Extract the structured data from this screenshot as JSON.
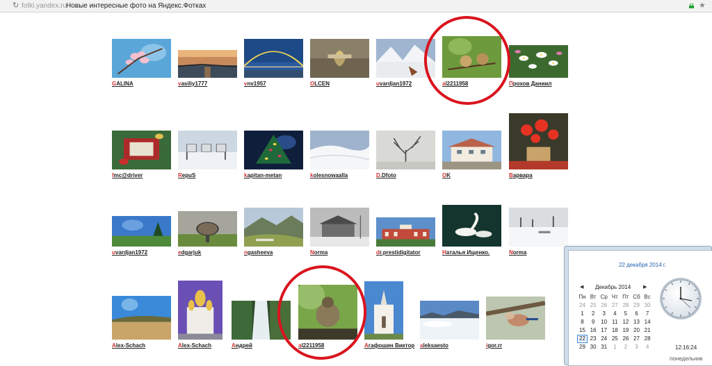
{
  "browser": {
    "reload_icon": "reload-icon",
    "domain": "fotki.yandex.ru",
    "page_title": "Новые интересные фото на Яндекс.Фотках",
    "lock_color": "#21a132"
  },
  "gallery": {
    "rows": [
      {
        "items": [
          {
            "author": "GALINA",
            "subject": "pink blossom"
          },
          {
            "author": "vasiliy1777",
            "subject": "sunset lake"
          },
          {
            "author": "vnv1957",
            "subject": "bridge arch"
          },
          {
            "author": "OLCEN",
            "subject": "church reflection"
          },
          {
            "author": "uvardjan1972",
            "subject": "snowy mountains"
          },
          {
            "author": "al2211958",
            "subject": "two birds"
          },
          {
            "author": "Прохов Даниил",
            "subject": "white flowers"
          }
        ]
      },
      {
        "items": [
          {
            "author": "fmc@driver",
            "subject": "christmas ornaments"
          },
          {
            "author": "RepuS",
            "subject": "horses in snow"
          },
          {
            "author": "kapitan-metan",
            "subject": "christmas tree"
          },
          {
            "author": "kolesnowaalla",
            "subject": "snowy field"
          },
          {
            "author": "D.Dfoto",
            "subject": "foggy tree"
          },
          {
            "author": "OK",
            "subject": "white house"
          },
          {
            "author": "Варвара",
            "subject": "red flowers basket"
          }
        ]
      },
      {
        "items": [
          {
            "author": "uvardjan1972",
            "subject": "tree under sky"
          },
          {
            "author": "edgarjuk",
            "subject": "sculpture park"
          },
          {
            "author": "ngasheeva",
            "subject": "mountain valley"
          },
          {
            "author": "Norma",
            "subject": "old house bw"
          },
          {
            "author": "dr.prestidigitator",
            "subject": "red palace"
          },
          {
            "author": "Наталья Ищенко.",
            "subject": "swans"
          },
          {
            "author": "Norma",
            "subject": "winter lake"
          }
        ]
      },
      {
        "items": [
          {
            "author": "Alex-Schach",
            "subject": "river coast"
          },
          {
            "author": "Alex-Schach",
            "subject": "cathedral"
          },
          {
            "author": "Андрей",
            "subject": "waterfall"
          },
          {
            "author": "al2211958",
            "subject": "thrush"
          },
          {
            "author": "Агафошин Виктор",
            "subject": "white church"
          },
          {
            "author": "aleksaesto",
            "subject": "sea of clouds"
          },
          {
            "author": "igor.rr",
            "subject": "bird on branch"
          }
        ]
      }
    ]
  },
  "annotations": {
    "circle_color": "#d9141e",
    "circles": [
      {
        "name": "highlight-circle-top",
        "target": "al2211958"
      },
      {
        "name": "highlight-circle-bottom",
        "target": "al2211958"
      }
    ]
  },
  "clock_popup": {
    "full_date": "22 декабря 2014 г.",
    "month_label": "Декабрь 2014",
    "prev_icon": "triangle-left-icon",
    "next_icon": "triangle-right-icon",
    "weekdays": [
      "Пн",
      "Вт",
      "Ср",
      "Чт",
      "Пт",
      "Сб",
      "Вс"
    ],
    "weeks": [
      [
        "24",
        "25",
        "26",
        "27",
        "28",
        "29",
        "30"
      ],
      [
        "1",
        "2",
        "3",
        "4",
        "5",
        "6",
        "7"
      ],
      [
        "8",
        "9",
        "10",
        "11",
        "12",
        "13",
        "14"
      ],
      [
        "15",
        "16",
        "17",
        "18",
        "19",
        "20",
        "21"
      ],
      [
        "22",
        "23",
        "24",
        "25",
        "26",
        "27",
        "28"
      ],
      [
        "29",
        "30",
        "31",
        "1",
        "2",
        "3",
        "4"
      ]
    ],
    "today": "22",
    "time": "12:16:24",
    "weekday": "понедельник",
    "clock_icon": "analog-clock-icon"
  }
}
